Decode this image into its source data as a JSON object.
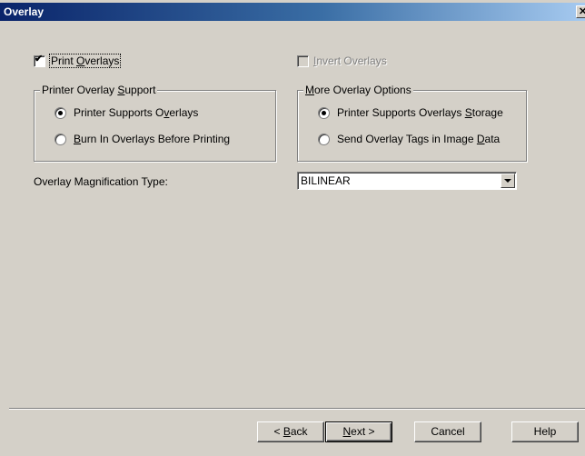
{
  "window": {
    "title": "Overlay",
    "close_label": "✕"
  },
  "options": {
    "print_overlays": {
      "label_pre": "Print ",
      "label_u": "O",
      "label_post": "verlays",
      "checked": true
    },
    "invert_overlays": {
      "label_pre": "",
      "label_u": "I",
      "label_post": "nvert Overlays",
      "checked": false,
      "enabled": false
    }
  },
  "printer_support": {
    "title_pre": "Printer Overlay ",
    "title_u": "S",
    "title_post": "upport",
    "items": [
      {
        "pre": "Printer Supports O",
        "u": "v",
        "post": "erlays",
        "selected": true
      },
      {
        "pre": "",
        "u": "B",
        "post": "urn In Overlays Before Printing",
        "selected": false
      }
    ]
  },
  "more_options": {
    "title_pre": "",
    "title_u": "M",
    "title_post": "ore Overlay Options",
    "items": [
      {
        "pre": "Printer Supports Overlays ",
        "u": "S",
        "post": "torage",
        "selected": true
      },
      {
        "pre": "Send Overlay Tags in Image ",
        "u": "D",
        "post": "ata",
        "selected": false
      }
    ]
  },
  "magnification": {
    "label": "Overlay Magnification Type:",
    "value": "BILINEAR"
  },
  "buttons": {
    "back": {
      "pre": "< ",
      "u": "B",
      "post": "ack"
    },
    "next": {
      "pre": "",
      "u": "N",
      "post": "ext >"
    },
    "cancel": "Cancel",
    "help": "Help"
  }
}
